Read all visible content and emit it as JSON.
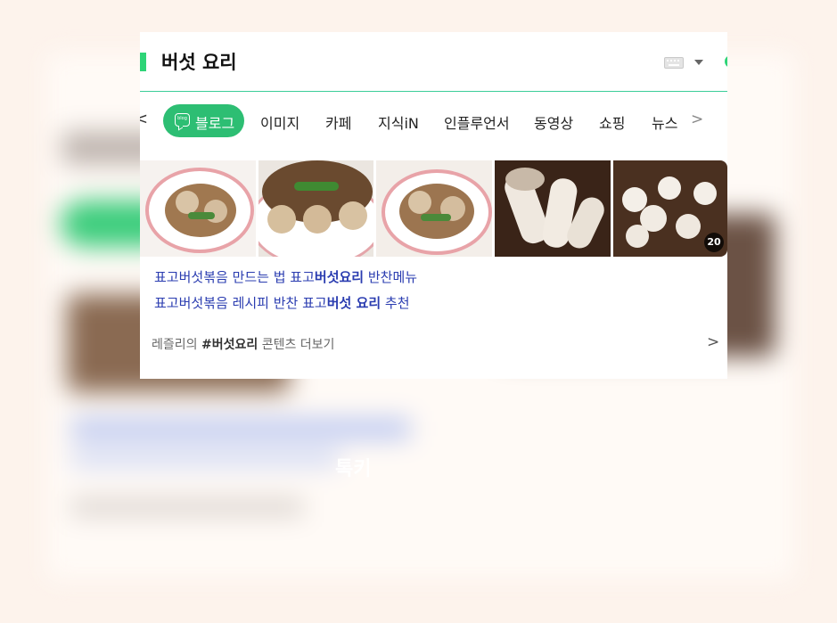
{
  "background": {
    "blurred_text": "톡키"
  },
  "search": {
    "query": "버섯 요리",
    "keyboard_icon": "keyboard-icon",
    "dropdown_icon": "caret-down-icon"
  },
  "tabs": {
    "prev_glyph": "<",
    "next_glyph": ">",
    "active": {
      "label": "블로그",
      "icon": "blog-icon",
      "icon_text": "blog"
    },
    "items": [
      "이미지",
      "카페",
      "지식iN",
      "인플루언서",
      "동영상",
      "쇼핑",
      "뉴스"
    ]
  },
  "gallery": {
    "image_count_badge": "20"
  },
  "results": [
    {
      "pre": "표고버섯볶음 만드는 법 표고",
      "bold": "버섯요리",
      "post": " 반찬메뉴"
    },
    {
      "pre": "표고버섯볶음 레시피 반찬 표고",
      "bold": "버섯 요리",
      "post": " 추천"
    }
  ],
  "more": {
    "pre": "레즐리의 ",
    "tag": "#버섯요리",
    "post": " 콘텐츠 더보기",
    "arrow": ">"
  },
  "colors": {
    "accent_green": "#2dbe73",
    "link_blue": "#2a3cb0",
    "divider": "#3ccd98"
  }
}
